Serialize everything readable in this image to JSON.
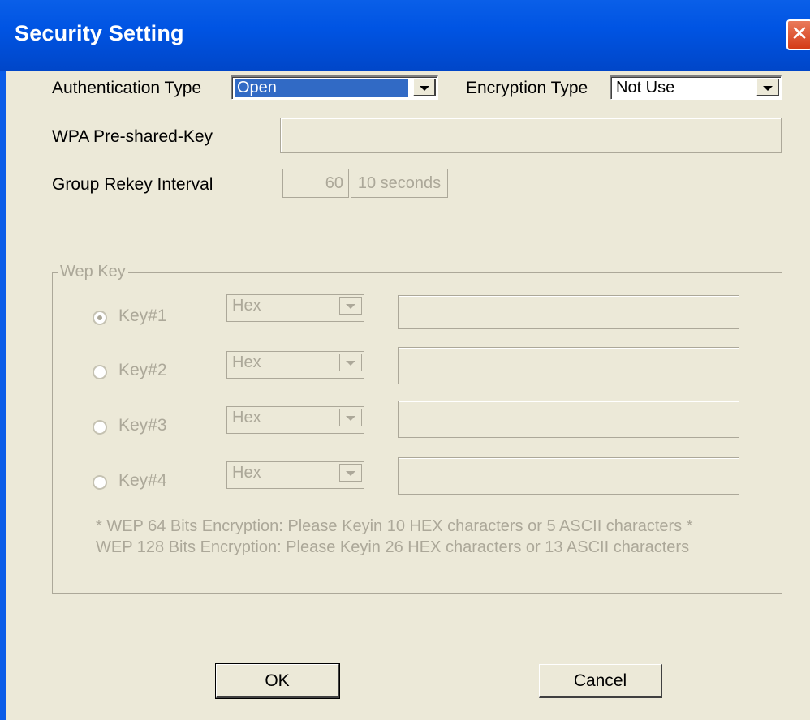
{
  "window": {
    "title": "Security Setting",
    "close_symbol": "✕"
  },
  "auth": {
    "label": "Authentication Type",
    "selected": "Open"
  },
  "encryption": {
    "label": "Encryption Type",
    "selected": "Not Use"
  },
  "wpa": {
    "label": "WPA Pre-shared-Key",
    "value": ""
  },
  "rekey": {
    "label": "Group Rekey Interval",
    "value": "60",
    "unit_button": "10 seconds"
  },
  "wep": {
    "legend": "Wep Key",
    "keys": [
      {
        "label": "Key#1",
        "format": "Hex",
        "value": "",
        "selected": true
      },
      {
        "label": "Key#2",
        "format": "Hex",
        "value": "",
        "selected": false
      },
      {
        "label": "Key#3",
        "format": "Hex",
        "value": "",
        "selected": false
      },
      {
        "label": "Key#4",
        "format": "Hex",
        "value": "",
        "selected": false
      }
    ],
    "note1": "* WEP 64 Bits Encryption:  Please Keyin 10 HEX characters or 5 ASCII characters *",
    "note2": "WEP 128 Bits Encryption:  Please Keyin 26 HEX characters or 13 ASCII characters"
  },
  "buttons": {
    "ok": "OK",
    "cancel": "Cancel"
  },
  "colors": {
    "titlebar": "#0054e3",
    "disabled_text": "#aca899",
    "dialog_bg": "#ece9d8",
    "selection": "#316ac5"
  }
}
